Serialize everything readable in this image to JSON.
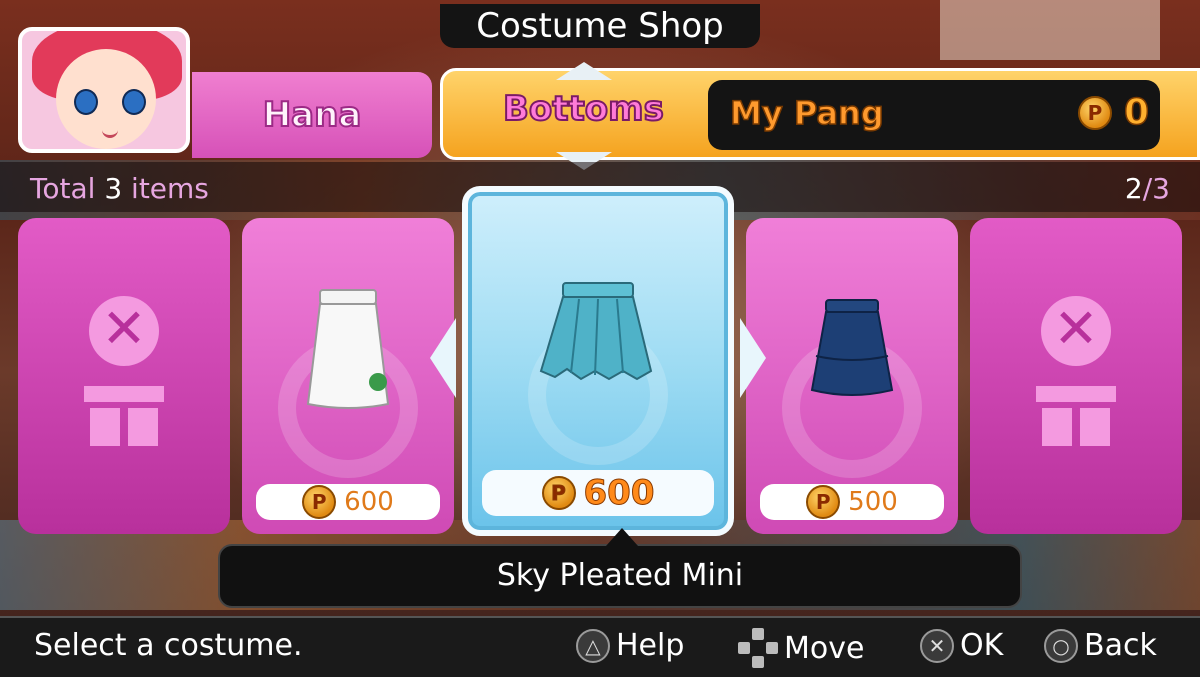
{
  "header": {
    "title": "Costume Shop",
    "character_name": "Hana",
    "category": "Bottoms",
    "wallet_label": "My Pang",
    "wallet_coin_symbol": "P",
    "wallet_amount": "0"
  },
  "info": {
    "total_prefix": "Total",
    "total_count": "3",
    "total_suffix": "items",
    "page_current": "2",
    "page_separator": "/",
    "page_total": "3"
  },
  "cards": [
    {
      "state": "unavailable",
      "icon": "x-gift-icon"
    },
    {
      "state": "item",
      "item": "white-skirt",
      "price": "600",
      "coin_symbol": "P",
      "color": "#f8f8f8"
    },
    {
      "state": "selected",
      "item": "sky-pleated-mini",
      "price": "600",
      "coin_symbol": "P",
      "color": "#4fb2c8"
    },
    {
      "state": "item",
      "item": "navy-skirt",
      "price": "500",
      "coin_symbol": "P",
      "color": "#1d3f75"
    },
    {
      "state": "unavailable",
      "icon": "x-gift-icon"
    }
  ],
  "selected_item_name": "Sky Pleated Mini",
  "footer": {
    "hint": "Select a costume.",
    "controls": [
      {
        "icon": "triangle-button-icon",
        "glyph": "△",
        "label": "Help"
      },
      {
        "icon": "dpad-icon",
        "label": "Move"
      },
      {
        "icon": "cross-button-icon",
        "glyph": "✕",
        "label": "OK"
      },
      {
        "icon": "circle-button-icon",
        "glyph": "○",
        "label": "Back"
      }
    ]
  },
  "colors": {
    "accent_pink": "#d651b8",
    "accent_orange": "#f5a31f",
    "selected_blue": "#9fdcf3"
  }
}
